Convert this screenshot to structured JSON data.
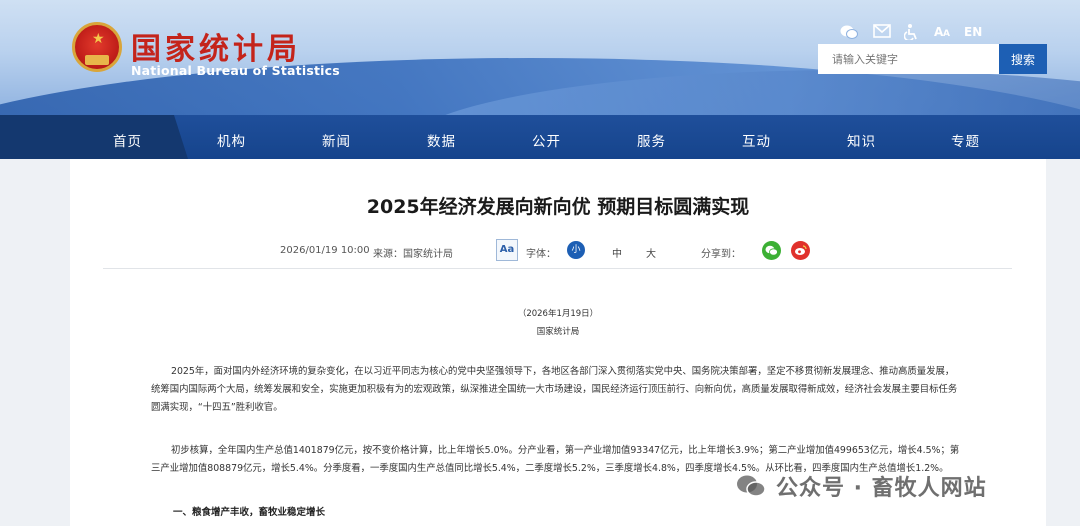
{
  "header": {
    "brand_cn": "国家统计局",
    "brand_en": "National Bureau of Statistics",
    "lang_toggle": "EN",
    "search_placeholder": "请输入关键字",
    "search_button": "搜索"
  },
  "nav": {
    "items": [
      {
        "label": "首页"
      },
      {
        "label": "机构"
      },
      {
        "label": "新闻"
      },
      {
        "label": "数据"
      },
      {
        "label": "公开"
      },
      {
        "label": "服务"
      },
      {
        "label": "互动"
      },
      {
        "label": "知识"
      },
      {
        "label": "专题"
      }
    ]
  },
  "article": {
    "title": "2025年经济发展向新向优 预期目标圆满实现",
    "date": "2026/01/19 10:00",
    "source": "来源：国家统计局",
    "font_toggle": "Aa",
    "font_label": "字体：",
    "font_small": "小",
    "font_medium": "中",
    "font_large": "大",
    "share_label": "分享到：",
    "dateline": "（2026年1月19日）",
    "byline": "国家统计局",
    "para1": "2025年，面对国内外经济环境的复杂变化，在以习近平同志为核心的党中央坚强领导下，各地区各部门深入贯彻落实党中央、国务院决策部署，坚定不移贯彻新发展理念、推动高质量发展，统筹国内国际两个大局，统筹发展和安全，实施更加积极有为的宏观政策，纵深推进全国统一大市场建设，国民经济运行顶压前行、向新向优，高质量发展取得新成效，经济社会发展主要目标任务圆满实现，“十四五”胜利收官。",
    "para2": "初步核算，全年国内生产总值1401879亿元，按不变价格计算，比上年增长5.0%。分产业看，第一产业增加值93347亿元，比上年增长3.9%；第二产业增加值499653亿元，增长4.5%；第三产业增加值808879亿元，增长5.4%。分季度看，一季度国内生产总值同比增长5.4%，二季度增长5.2%，三季度增长4.8%，四季度增长4.5%。从环比看，四季度国内生产总值增长1.2%。",
    "section1": "一、粮食增产丰收，畜牧业稳定增长"
  },
  "watermark": "公众号 · 畜牧人网站",
  "icons": [
    "wechat-icon",
    "mail-icon",
    "accessibility-icon",
    "wechat-share-icon",
    "weibo-share-icon"
  ],
  "colors": {
    "brand_red": "#c4241b",
    "nav_blue": "#1f4f9b",
    "search_blue": "#1d5fb4",
    "wechat_green": "#3cb034",
    "weibo_red": "#e0312c"
  }
}
